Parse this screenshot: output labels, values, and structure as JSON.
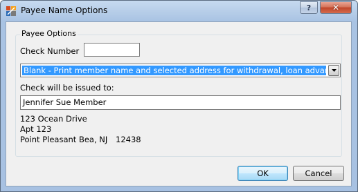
{
  "window": {
    "title": "Payee Name Options",
    "help_glyph": "?",
    "close_glyph": "✕"
  },
  "group": {
    "legend": "Payee Options",
    "check_number_label": "Check Number",
    "check_number_value": "",
    "payee_type_selected": "Blank - Print member name and selected address for withdrawal, loan advance",
    "issued_to_label": "Check will be issued to:",
    "payee_name": "Jennifer Sue Member",
    "address": {
      "line1": "123 Ocean Drive",
      "line2": "Apt 123",
      "city_state": "Point Pleasant Bea, NJ",
      "zip": "12438"
    }
  },
  "buttons": {
    "ok": "OK",
    "cancel": "Cancel"
  },
  "colors": {
    "selection": "#3399ff",
    "dialog_bg": "#f0f0f0",
    "frame": "#a9c3e3",
    "close": "#c0452a"
  },
  "icons": {
    "app": "app-logo-icon",
    "dropdown": "chevron-down-icon"
  }
}
